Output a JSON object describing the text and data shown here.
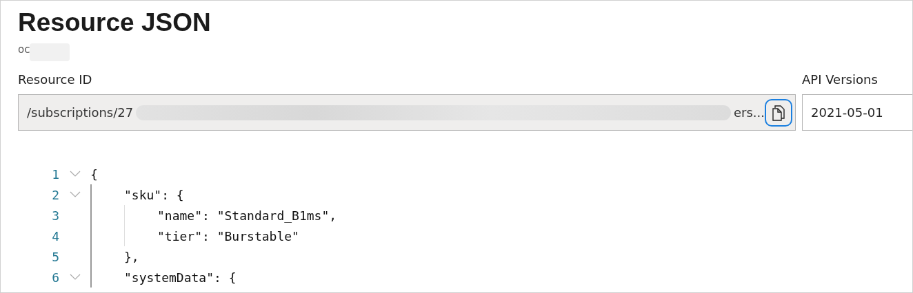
{
  "title": "Resource JSON",
  "subtitle": "oc",
  "resource_id": {
    "label": "Resource ID",
    "value_start": "/subscriptions/27",
    "value_end": "ers..."
  },
  "api_versions": {
    "label": "API Versions",
    "value": "2021-05-01"
  },
  "code_lines": [
    {
      "number": "1",
      "foldable": true,
      "text": "{"
    },
    {
      "number": "2",
      "foldable": true,
      "text": "    \"sku\": {"
    },
    {
      "number": "3",
      "foldable": false,
      "text": "        \"name\": \"Standard_B1ms\","
    },
    {
      "number": "4",
      "foldable": false,
      "text": "        \"tier\": \"Burstable\""
    },
    {
      "number": "5",
      "foldable": false,
      "text": "    },"
    },
    {
      "number": "6",
      "foldable": true,
      "text": "    \"systemData\": {"
    }
  ]
}
